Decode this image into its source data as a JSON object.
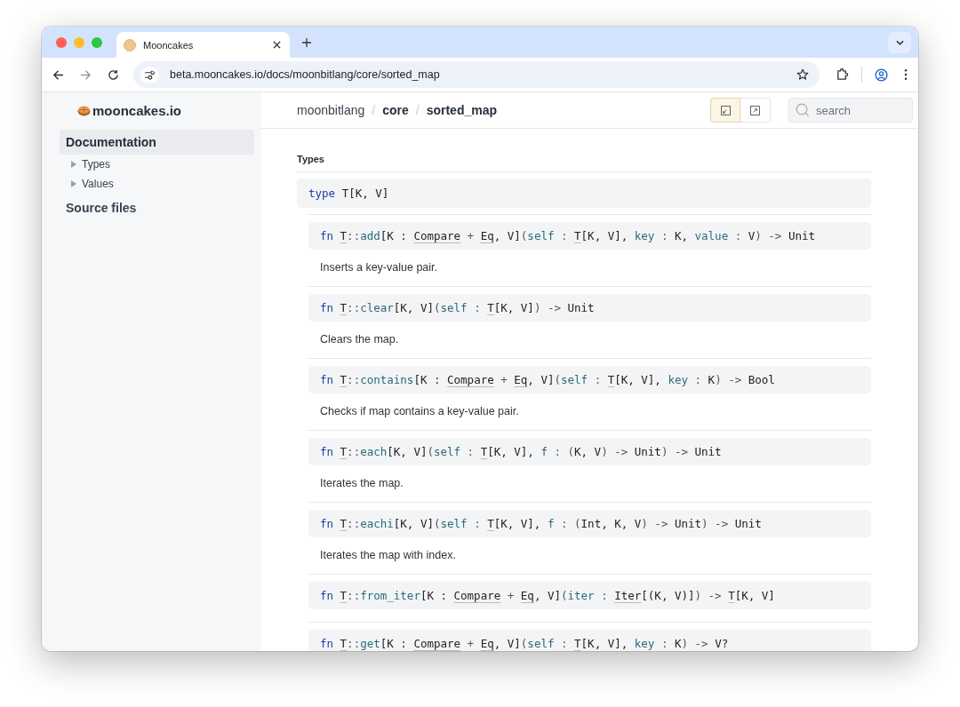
{
  "window": {
    "tab": {
      "title": "Mooncakes"
    },
    "url": "beta.mooncakes.io/docs/moonbitlang/core/sorted_map"
  },
  "sidebar": {
    "logo": "mooncakes.io",
    "items": [
      {
        "label": "Documentation",
        "selected": true,
        "children": [
          {
            "label": "Types",
            "expanded": false
          },
          {
            "label": "Values",
            "expanded": false
          }
        ]
      },
      {
        "label": "Source files",
        "selected": false
      }
    ]
  },
  "breadcrumb": [
    {
      "kind": "link",
      "label": "moonbitlang",
      "bold": false
    },
    {
      "kind": "separator",
      "label": "/"
    },
    {
      "kind": "link",
      "label": "core",
      "bold": true
    },
    {
      "kind": "separator",
      "label": "/"
    },
    {
      "kind": "link",
      "label": "sorted_map",
      "bold": true
    }
  ],
  "view_toggles": [
    {
      "selected": true
    },
    {
      "selected": false
    }
  ],
  "search": {
    "placeholder": "search"
  },
  "section": {
    "heading": "Types",
    "type_decl": [
      {
        "kind": "keyword",
        "text": "type "
      },
      {
        "kind": "plain",
        "text": "T[K, V]"
      }
    ],
    "methods": [
      {
        "signature": [
          {
            "kind": "keyword",
            "text": "fn "
          },
          {
            "kind": "type",
            "text": "T"
          },
          {
            "kind": "punct",
            "text": "::"
          },
          {
            "kind": "name",
            "text": "add"
          },
          {
            "kind": "plain",
            "text": "[K : "
          },
          {
            "kind": "type",
            "text": "Compare"
          },
          {
            "kind": "punct",
            "text": " + "
          },
          {
            "kind": "type",
            "text": "Eq"
          },
          {
            "kind": "plain",
            "text": ", V]"
          },
          {
            "kind": "punct",
            "text": "("
          },
          {
            "kind": "param",
            "text": "self"
          },
          {
            "kind": "punct",
            "text": " : "
          },
          {
            "kind": "type",
            "text": "T"
          },
          {
            "kind": "plain",
            "text": "[K, V], "
          },
          {
            "kind": "param",
            "text": "key"
          },
          {
            "kind": "punct",
            "text": " : "
          },
          {
            "kind": "plain",
            "text": "K, "
          },
          {
            "kind": "param",
            "text": "value"
          },
          {
            "kind": "punct",
            "text": " : "
          },
          {
            "kind": "plain",
            "text": "V"
          },
          {
            "kind": "punct",
            "text": ") -> "
          },
          {
            "kind": "plain",
            "text": "Unit"
          }
        ],
        "description": "Inserts a key-value pair."
      },
      {
        "signature": [
          {
            "kind": "keyword",
            "text": "fn "
          },
          {
            "kind": "type",
            "text": "T"
          },
          {
            "kind": "punct",
            "text": "::"
          },
          {
            "kind": "name",
            "text": "clear"
          },
          {
            "kind": "plain",
            "text": "[K, V]"
          },
          {
            "kind": "punct",
            "text": "("
          },
          {
            "kind": "param",
            "text": "self"
          },
          {
            "kind": "punct",
            "text": " : "
          },
          {
            "kind": "type",
            "text": "T"
          },
          {
            "kind": "plain",
            "text": "[K, V]"
          },
          {
            "kind": "punct",
            "text": ") -> "
          },
          {
            "kind": "plain",
            "text": "Unit"
          }
        ],
        "description": "Clears the map."
      },
      {
        "signature": [
          {
            "kind": "keyword",
            "text": "fn "
          },
          {
            "kind": "type",
            "text": "T"
          },
          {
            "kind": "punct",
            "text": "::"
          },
          {
            "kind": "name",
            "text": "contains"
          },
          {
            "kind": "plain",
            "text": "[K : "
          },
          {
            "kind": "type",
            "text": "Compare"
          },
          {
            "kind": "punct",
            "text": " + "
          },
          {
            "kind": "type",
            "text": "Eq"
          },
          {
            "kind": "plain",
            "text": ", V]"
          },
          {
            "kind": "punct",
            "text": "("
          },
          {
            "kind": "param",
            "text": "self"
          },
          {
            "kind": "punct",
            "text": " : "
          },
          {
            "kind": "type",
            "text": "T"
          },
          {
            "kind": "plain",
            "text": "[K, V], "
          },
          {
            "kind": "param",
            "text": "key"
          },
          {
            "kind": "punct",
            "text": " : "
          },
          {
            "kind": "plain",
            "text": "K"
          },
          {
            "kind": "punct",
            "text": ") -> "
          },
          {
            "kind": "plain",
            "text": "Bool"
          }
        ],
        "description": "Checks if map contains a key-value pair."
      },
      {
        "signature": [
          {
            "kind": "keyword",
            "text": "fn "
          },
          {
            "kind": "type",
            "text": "T"
          },
          {
            "kind": "punct",
            "text": "::"
          },
          {
            "kind": "name",
            "text": "each"
          },
          {
            "kind": "plain",
            "text": "[K, V]"
          },
          {
            "kind": "punct",
            "text": "("
          },
          {
            "kind": "param",
            "text": "self"
          },
          {
            "kind": "punct",
            "text": " : "
          },
          {
            "kind": "type",
            "text": "T"
          },
          {
            "kind": "plain",
            "text": "[K, V], "
          },
          {
            "kind": "param",
            "text": "f"
          },
          {
            "kind": "punct",
            "text": " : ("
          },
          {
            "kind": "plain",
            "text": "K, V"
          },
          {
            "kind": "punct",
            "text": ") -> "
          },
          {
            "kind": "plain",
            "text": "Unit"
          },
          {
            "kind": "punct",
            "text": ") -> "
          },
          {
            "kind": "plain",
            "text": "Unit"
          }
        ],
        "description": "Iterates the map."
      },
      {
        "signature": [
          {
            "kind": "keyword",
            "text": "fn "
          },
          {
            "kind": "type",
            "text": "T"
          },
          {
            "kind": "punct",
            "text": "::"
          },
          {
            "kind": "name",
            "text": "eachi"
          },
          {
            "kind": "plain",
            "text": "[K, V]"
          },
          {
            "kind": "punct",
            "text": "("
          },
          {
            "kind": "param",
            "text": "self"
          },
          {
            "kind": "punct",
            "text": " : "
          },
          {
            "kind": "type",
            "text": "T"
          },
          {
            "kind": "plain",
            "text": "[K, V], "
          },
          {
            "kind": "param",
            "text": "f"
          },
          {
            "kind": "punct",
            "text": " : ("
          },
          {
            "kind": "plain",
            "text": "Int, K, V"
          },
          {
            "kind": "punct",
            "text": ") -> "
          },
          {
            "kind": "plain",
            "text": "Unit"
          },
          {
            "kind": "punct",
            "text": ") -> "
          },
          {
            "kind": "plain",
            "text": "Unit"
          }
        ],
        "description": "Iterates the map with index."
      },
      {
        "signature": [
          {
            "kind": "keyword",
            "text": "fn "
          },
          {
            "kind": "type",
            "text": "T"
          },
          {
            "kind": "punct",
            "text": "::"
          },
          {
            "kind": "name",
            "text": "from_iter"
          },
          {
            "kind": "plain",
            "text": "[K : "
          },
          {
            "kind": "type",
            "text": "Compare"
          },
          {
            "kind": "punct",
            "text": " + "
          },
          {
            "kind": "type",
            "text": "Eq"
          },
          {
            "kind": "plain",
            "text": ", V]"
          },
          {
            "kind": "punct",
            "text": "("
          },
          {
            "kind": "param",
            "text": "iter"
          },
          {
            "kind": "punct",
            "text": " : "
          },
          {
            "kind": "type",
            "text": "Iter"
          },
          {
            "kind": "plain",
            "text": "[(K, V)]"
          },
          {
            "kind": "punct",
            "text": ") -> "
          },
          {
            "kind": "type",
            "text": "T"
          },
          {
            "kind": "plain",
            "text": "[K, V]"
          }
        ]
      },
      {
        "signature": [
          {
            "kind": "keyword",
            "text": "fn "
          },
          {
            "kind": "type",
            "text": "T"
          },
          {
            "kind": "punct",
            "text": "::"
          },
          {
            "kind": "name",
            "text": "get"
          },
          {
            "kind": "plain",
            "text": "[K : "
          },
          {
            "kind": "type",
            "text": "Compare"
          },
          {
            "kind": "punct",
            "text": " + "
          },
          {
            "kind": "type",
            "text": "Eq"
          },
          {
            "kind": "plain",
            "text": ", V]"
          },
          {
            "kind": "punct",
            "text": "("
          },
          {
            "kind": "param",
            "text": "self"
          },
          {
            "kind": "punct",
            "text": " : "
          },
          {
            "kind": "type",
            "text": "T"
          },
          {
            "kind": "plain",
            "text": "[K, V], "
          },
          {
            "kind": "param",
            "text": "key"
          },
          {
            "kind": "punct",
            "text": " : "
          },
          {
            "kind": "plain",
            "text": "K"
          },
          {
            "kind": "punct",
            "text": ") -> "
          },
          {
            "kind": "plain",
            "text": "V?"
          }
        ]
      }
    ]
  }
}
